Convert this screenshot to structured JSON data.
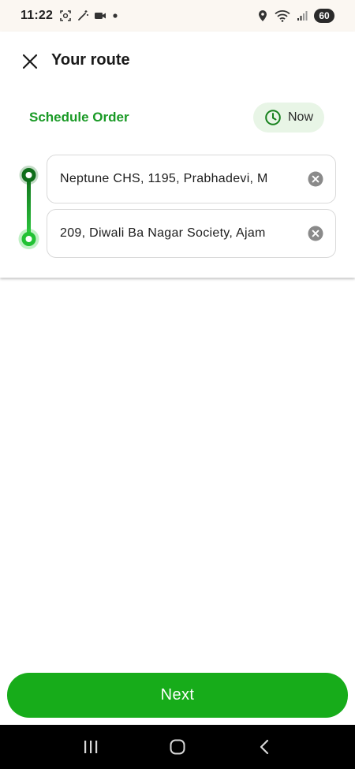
{
  "status_bar": {
    "time": "11:22",
    "battery": "60",
    "icons": [
      "screenshot-icon",
      "magic-wand-icon",
      "video-camera-icon",
      "dot-icon",
      "location-icon",
      "wifi-icon",
      "signal-icon"
    ]
  },
  "header": {
    "title": "Your route",
    "close_icon": "close-icon"
  },
  "schedule": {
    "label": "Schedule Order",
    "now_label": "Now",
    "icon": "clock-icon"
  },
  "route": {
    "pickup": "Neptune CHS, 1195, Prabhadevi, M",
    "drop": "209, Diwali Ba Nagar Society, Ajam",
    "clear_icon": "clear-circle-icon"
  },
  "actions": {
    "next_label": "Next"
  },
  "nav_bar": {
    "icons": [
      "recent-apps-icon",
      "home-icon",
      "back-icon"
    ]
  },
  "colors": {
    "brand_green": "#17ac1a",
    "schedule_green": "#1a9a26",
    "route_dark_green": "#0f6e1a",
    "route_light_green": "#2ecc40",
    "chip_bg": "#e8f5e6"
  }
}
